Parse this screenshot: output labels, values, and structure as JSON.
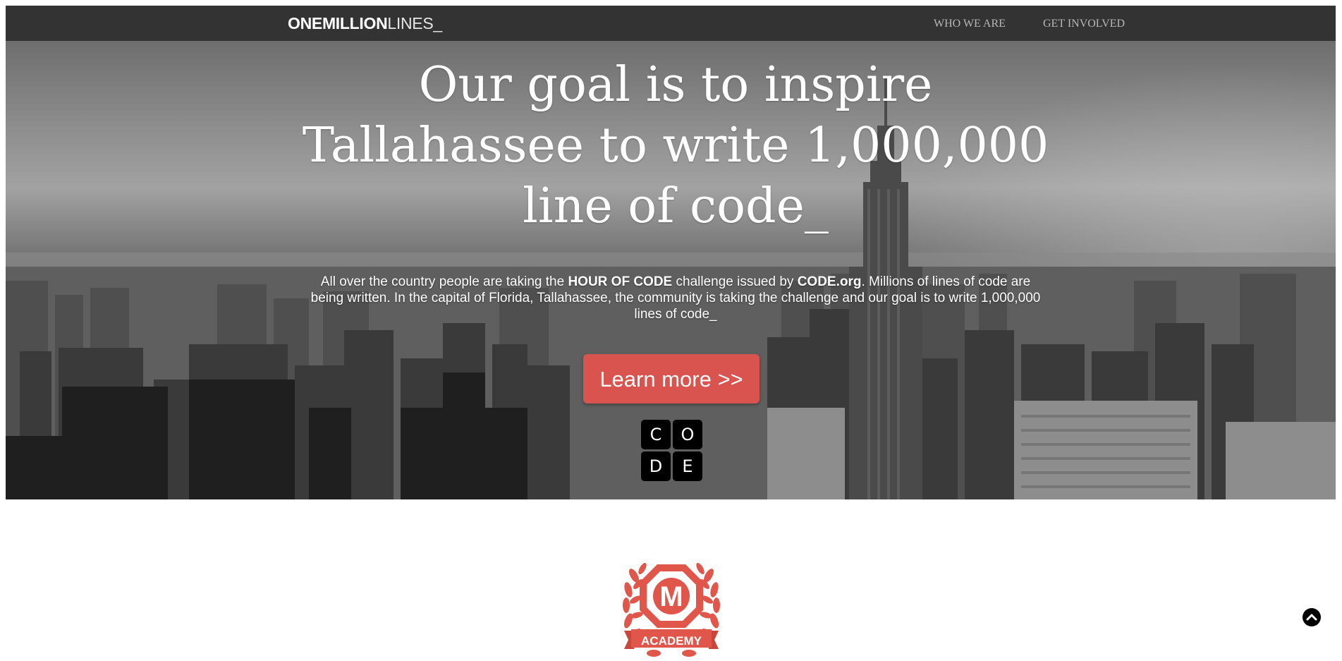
{
  "navbar": {
    "brand_bold": "ONEMILLION",
    "brand_thin": "LINES_",
    "links": [
      {
        "label": "WHO WE ARE"
      },
      {
        "label": "GET INVOLVED"
      }
    ]
  },
  "hero": {
    "headline_line1": "Our goal is to inspire",
    "headline_line2": "Tallahassee to write 1,000,000",
    "headline_line3": "line of code_",
    "lede": {
      "part1": "All over the country people are taking the ",
      "strong1": "HOUR OF CODE",
      "part2": " challenge issued by ",
      "strong2": "CODE.org",
      "part3": ". Millions of lines of code are being written. In the capital of Florida, Tallahassee, the community is taking the challenge and our goal is to write 1,000,000 lines of code_"
    },
    "cta_label": "Learn more >>",
    "code_logo_letters": [
      "C",
      "O",
      "D",
      "E"
    ]
  },
  "badge": {
    "letter": "M",
    "label": "ACADEMY"
  },
  "colors": {
    "navbar_bg": "#333333",
    "accent_red": "#d9534f",
    "nav_link": "#b8b8b8"
  },
  "icons": {
    "back_to_top": "chevron-up-circle-icon"
  }
}
